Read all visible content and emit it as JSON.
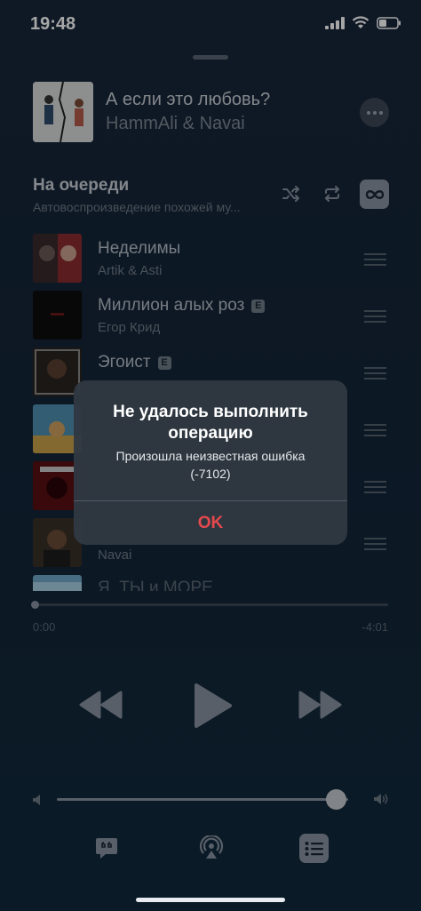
{
  "status_bar": {
    "time": "19:48"
  },
  "now_playing": {
    "title": "А если это любовь?",
    "artist": "HammAli & Navai"
  },
  "queue": {
    "title": "На очереди",
    "subtitle": "Автовоспроизведение похожей му..."
  },
  "tracks": [
    {
      "title": "Неделимы",
      "artist": "Artik & Asti",
      "explicit": false
    },
    {
      "title": "Миллион алых роз",
      "artist": "Егор Крид",
      "explicit": true,
      "badge": "E"
    },
    {
      "title": "Эгоист",
      "artist": "",
      "explicit": true,
      "badge": "E"
    },
    {
      "title": "",
      "artist": "",
      "explicit": false
    },
    {
      "title": "",
      "artist": "",
      "explicit": false
    },
    {
      "title": "",
      "artist": "Navai",
      "explicit": false
    },
    {
      "title": "Я, ТЫ и МОРЕ",
      "artist": "",
      "explicit": false
    }
  ],
  "playback": {
    "elapsed": "0:00",
    "remaining": "-4:01",
    "progress_fraction": 0,
    "volume_fraction": 0.96
  },
  "alert": {
    "title": "Не удалось выполнить операцию",
    "message": "Произошла неизвестная ошибка (-7102)",
    "ok_label": "OK"
  },
  "colors": {
    "background": "#132638",
    "alert_ok": "#e5484d"
  },
  "icons": {
    "shuffle": "shuffle-icon",
    "repeat": "repeat-icon",
    "infinity": "infinity-icon",
    "prev": "rewind-icon",
    "play": "play-icon",
    "next": "fast-forward-icon",
    "lyrics": "lyrics-icon",
    "airplay": "airplay-icon",
    "queue": "queue-list-icon"
  }
}
